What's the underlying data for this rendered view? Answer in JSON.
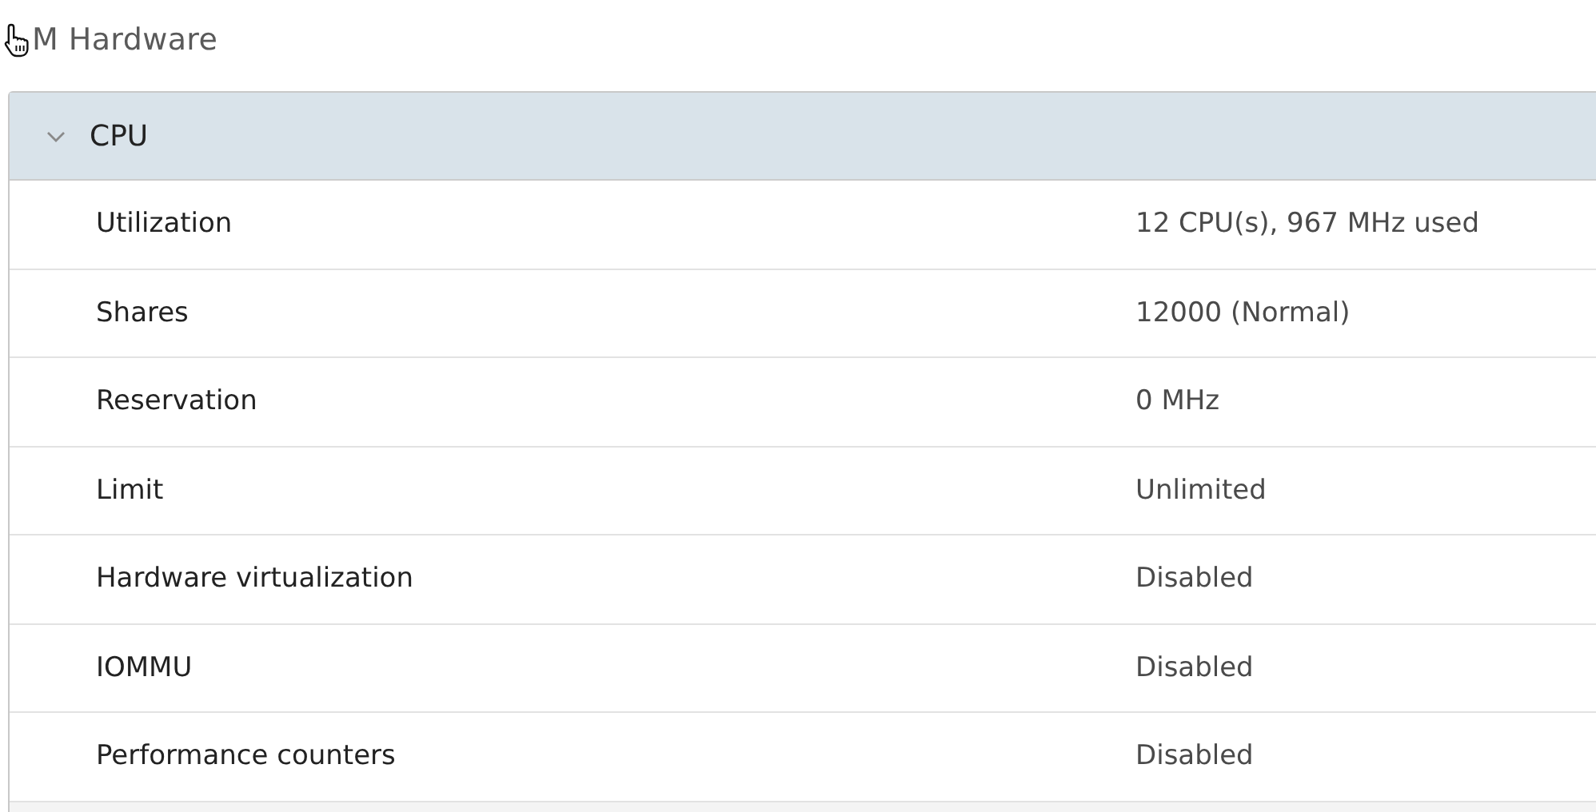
{
  "title": "M Hardware",
  "section": {
    "label": "CPU",
    "expanded": true,
    "rows": [
      {
        "label": "Utilization",
        "value": "12 CPU(s), 967 MHz used"
      },
      {
        "label": "Shares",
        "value": "12000 (Normal)"
      },
      {
        "label": "Reservation",
        "value": "0 MHz"
      },
      {
        "label": "Limit",
        "value": "Unlimited"
      },
      {
        "label": "Hardware virtualization",
        "value": "Disabled"
      },
      {
        "label": "IOMMU",
        "value": "Disabled"
      },
      {
        "label": "Performance counters",
        "value": "Disabled"
      }
    ]
  }
}
